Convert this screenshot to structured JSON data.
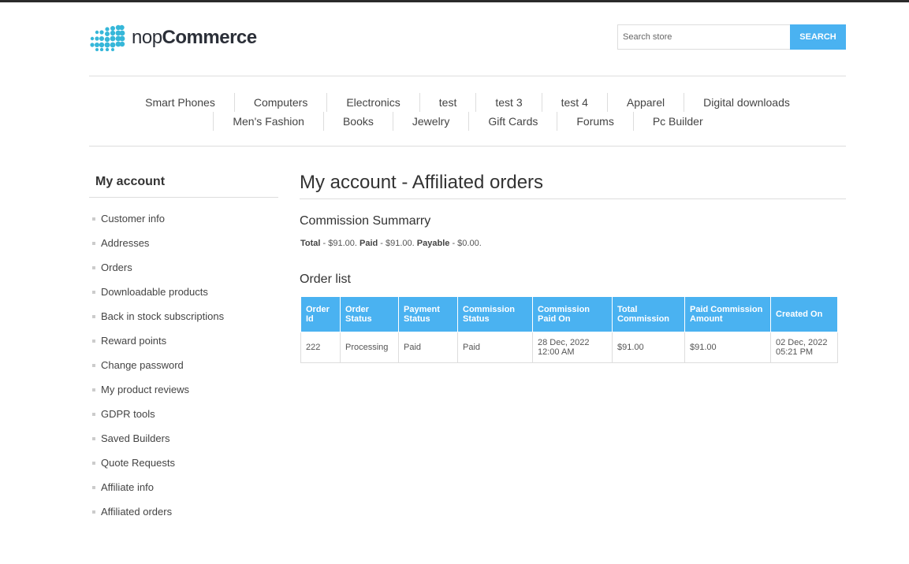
{
  "header": {
    "logo_text_light": "nop",
    "logo_text_bold": "Commerce",
    "search_placeholder": "Search store",
    "search_button": "Search"
  },
  "menu": {
    "row1": [
      "Smart Phones",
      "Computers",
      "Electronics",
      "test",
      "test 3",
      "test 4",
      "Apparel",
      "Digital downloads"
    ],
    "row2": [
      "Men's Fashion",
      "Books",
      "Jewelry",
      "Gift Cards",
      "Forums",
      "Pc Builder"
    ]
  },
  "sidebar": {
    "title": "My account",
    "items": [
      "Customer info",
      "Addresses",
      "Orders",
      "Downloadable products",
      "Back in stock subscriptions",
      "Reward points",
      "Change password",
      "My product reviews",
      "GDPR tools",
      "Saved Builders",
      "Quote Requests",
      "Affiliate info",
      "Affiliated orders"
    ]
  },
  "main": {
    "title": "My account - Affiliated orders",
    "summary_title": "Commission Summarry",
    "summary": {
      "total_label": "Total",
      "total_value": " - $91.00. ",
      "paid_label": "Paid",
      "paid_value": " - $91.00. ",
      "payable_label": "Payable",
      "payable_value": " - $0.00."
    },
    "order_list_title": "Order list",
    "table": {
      "headers": [
        "Order Id",
        "Order Status",
        "Payment Status",
        "Commission Status",
        "Commission Paid On",
        "Total Commission",
        "Paid Commission Amount",
        "Created On"
      ],
      "rows": [
        [
          "222",
          "Processing",
          "Paid",
          "Paid",
          "28 Dec, 2022 12:00 AM",
          "$91.00",
          "$91.00",
          "02 Dec, 2022 05:21 PM"
        ]
      ]
    }
  },
  "colors": {
    "accent": "#4ab2f1",
    "logo_dots": "#36b7d9"
  }
}
